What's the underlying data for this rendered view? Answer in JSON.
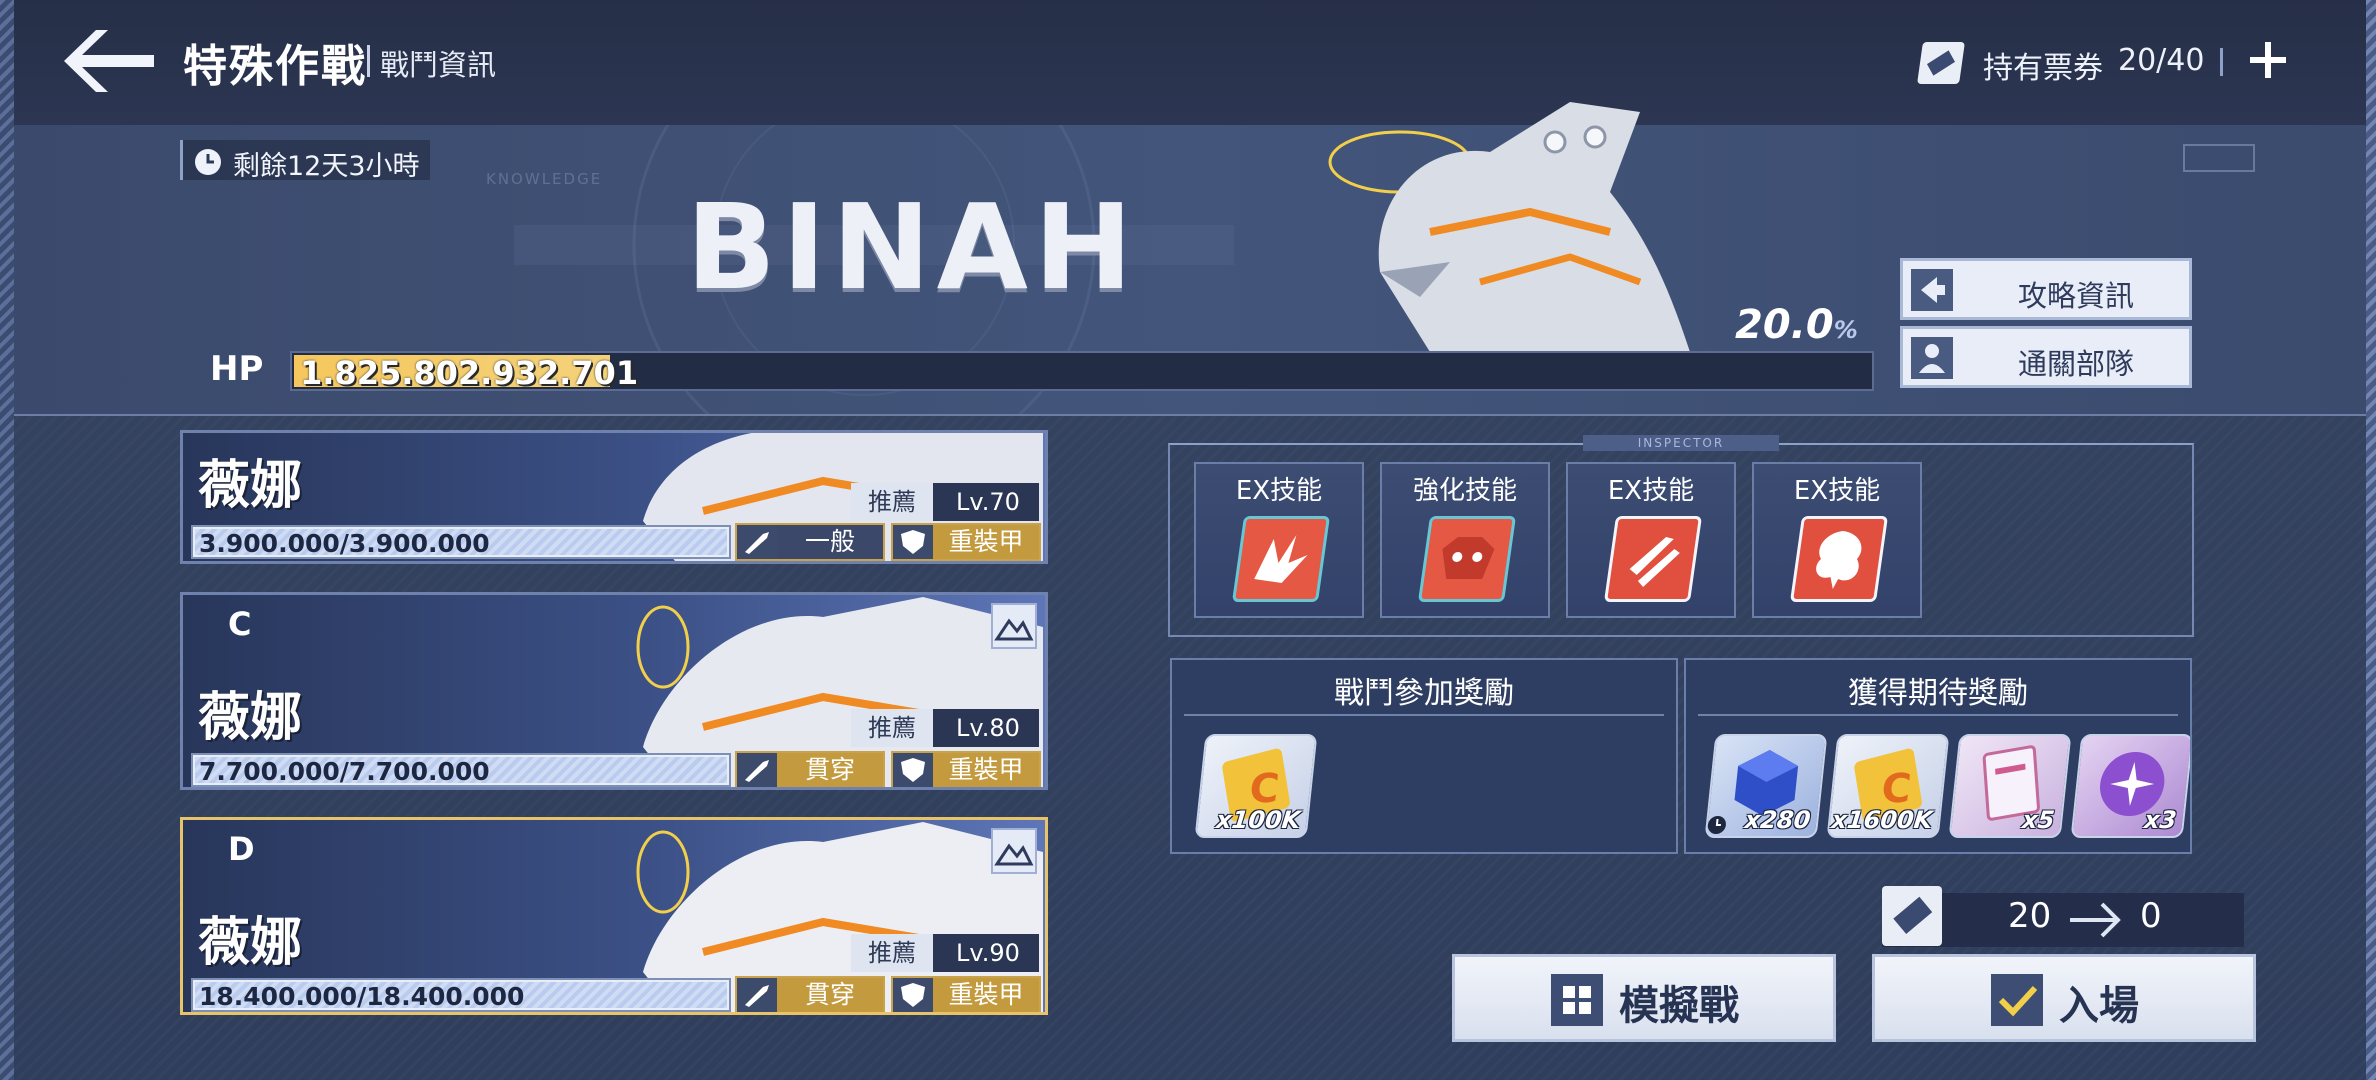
{
  "header": {
    "title": "特殊作戰",
    "subtitle": "戰鬥資訊",
    "ticket_label": "持有票券",
    "ticket_count": "20/40"
  },
  "banner": {
    "remaining": "剩餘12天3小時",
    "watermark": "KNOWLEDGE",
    "boss_name": "BINAH",
    "hp_label": "HP",
    "hp_value": "1.825.802.932.701",
    "hp_fill_fraction": 0.2,
    "hp_percent": "20.0",
    "hp_percent_unit": "%"
  },
  "side_buttons": {
    "strategy": "攻略資訊",
    "clear_team": "通關部隊"
  },
  "cards": [
    {
      "letter": "",
      "name": "薇娜",
      "rec": "推薦",
      "level": "Lv.70",
      "hp": "3.900.000/3.900.000",
      "attack": "一般",
      "defense": "重裝甲"
    },
    {
      "letter": "C",
      "name": "薇娜",
      "rec": "推薦",
      "level": "Lv.80",
      "hp": "7.700.000/7.700.000",
      "attack": "貫穿",
      "defense": "重裝甲"
    },
    {
      "letter": "D",
      "name": "薇娜",
      "rec": "推薦",
      "level": "Lv.90",
      "hp": "18.400.000/18.400.000",
      "attack": "貫穿",
      "defense": "重裝甲"
    }
  ],
  "skills": {
    "inspector": "INSPECTOR",
    "items": [
      {
        "label": "EX技能",
        "icon": "burst-icon"
      },
      {
        "label": "強化技能",
        "icon": "beast-face-icon"
      },
      {
        "label": "EX技能",
        "icon": "missiles-icon"
      },
      {
        "label": "EX技能",
        "icon": "explosion-icon"
      }
    ]
  },
  "rewards": {
    "participation_title": "戰鬥參加獎勵",
    "participation_items": [
      {
        "icon": "credit-card-icon",
        "qty": "x100K"
      }
    ],
    "expected_title": "獲得期待獎勵",
    "expected_items": [
      {
        "icon": "blue-cube-icon",
        "qty": "x280"
      },
      {
        "icon": "credit-card-icon",
        "qty": "x1600K"
      },
      {
        "icon": "report-icon",
        "qty": "x5"
      },
      {
        "icon": "purple-orb-icon",
        "qty": "x3"
      }
    ]
  },
  "cost": {
    "from": "20",
    "to": "0"
  },
  "actions": {
    "simulate": "模擬戰",
    "enter": "入場"
  },
  "colors": {
    "accent_gold": "#e7c46a",
    "hp_fill": "#f5c75d",
    "skill_red": "#e1503e"
  }
}
